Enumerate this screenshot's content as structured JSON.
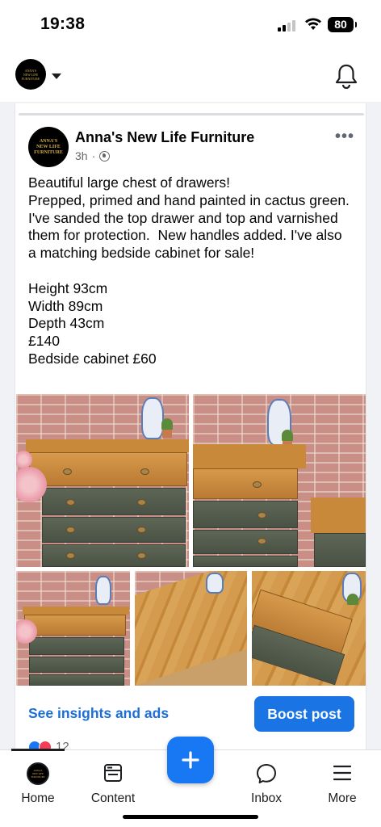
{
  "status_bar": {
    "time": "19:38",
    "battery": "80"
  },
  "page": {
    "logo_lines": [
      "ANNA'S",
      "NEW LIFE",
      "FURNITURE"
    ]
  },
  "post": {
    "author": "Anna's New Life Furniture",
    "time": "3h",
    "separator": "·",
    "more": "•••",
    "text": "Beautiful large chest of drawers!\nPrepped, primed and hand painted in cactus green. I've sanded the top drawer and top and varnished them for protection.  New handles added. I've also a matching bedside cabinet for sale!\n\nHeight 93cm\nWidth 89cm\nDepth 43cm\n£140\nBedside cabinet £60",
    "insights_label": "See insights and ads",
    "boost_label": "Boost post",
    "reaction_count": "12"
  },
  "nav": {
    "home": "Home",
    "content": "Content",
    "inbox": "Inbox",
    "more": "More",
    "fab": "+"
  },
  "colors": {
    "accent": "#1b74e4",
    "link": "#1d6fd6",
    "dresser_green": "#4f574a",
    "pine": "#c8893a"
  }
}
